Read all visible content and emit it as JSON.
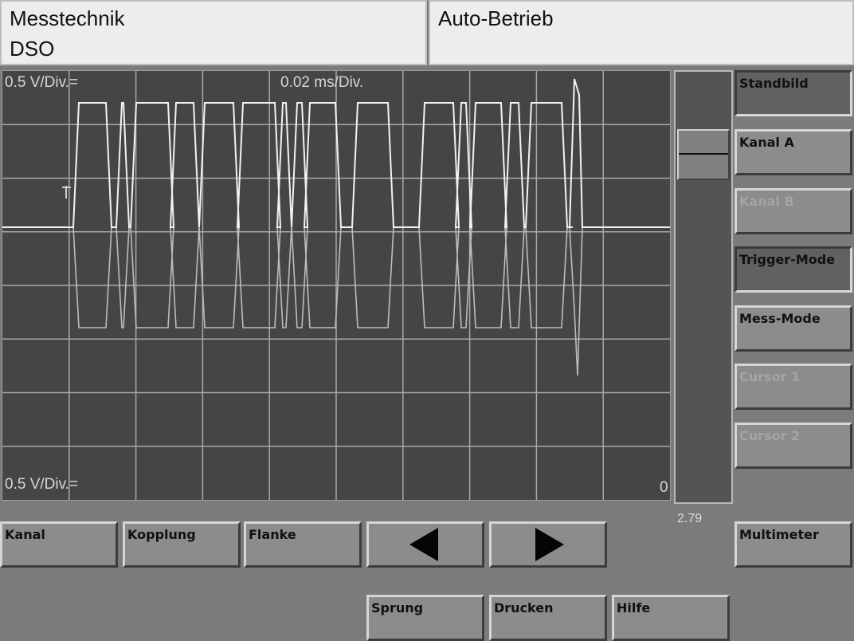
{
  "header": {
    "app_title": "Messtechnik",
    "mode": "DSO",
    "status": "Auto-Betrieb"
  },
  "scope": {
    "channel_a_scale": "0.5 V/Div.=",
    "timebase": "0.02 ms/Div.",
    "channel_b_scale": "0.5 V/Div.=",
    "zero_marker": "0",
    "grid_divisions": {
      "x": 10,
      "y": 8
    }
  },
  "slider": {
    "value": "2.79"
  },
  "side_buttons": [
    {
      "label": "Standbild",
      "state": "pressed"
    },
    {
      "label": "Kanal A",
      "state": "normal"
    },
    {
      "label": "Kanal B",
      "state": "disabled"
    },
    {
      "label": "Trigger-Mode",
      "state": "pressed"
    },
    {
      "label": "Mess-Mode",
      "state": "normal"
    },
    {
      "label": "Cursor 1",
      "state": "disabled"
    },
    {
      "label": "Cursor 2",
      "state": "disabled"
    }
  ],
  "multimeter_label": "Multimeter",
  "bottom_row1": [
    {
      "label": "Kanal"
    },
    {
      "label": "Kopplung"
    },
    {
      "label": "Flanke"
    },
    {
      "icon": "left-arrow-icon"
    },
    {
      "icon": "right-arrow-icon"
    }
  ],
  "bottom_row2": [
    {
      "label": "Sprung"
    },
    {
      "label": "Drucken"
    },
    {
      "label": "Hilfe"
    }
  ],
  "colors": {
    "screen_bg": "#454545",
    "grid": "#a8a8a8",
    "trace_a": "#f2f2f2",
    "trace_b": "#bdbdbd"
  }
}
